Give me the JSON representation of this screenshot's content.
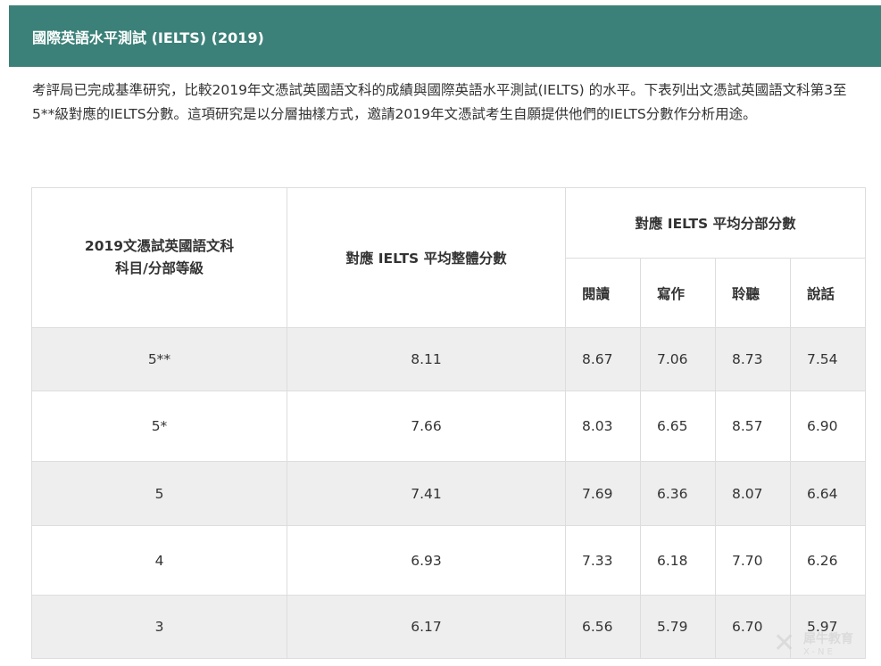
{
  "header": {
    "title": "國際英語水平測試 (IELTS) (2019)"
  },
  "intro": {
    "text": "考評局已完成基準研究，比較2019年文憑試英國語文科的成績與國際英語水平測試(IELTS) 的水平。下表列出文憑試英國語文科第3至5**級對應的IELTS分數。這項研究是以分層抽樣方式，邀請2019年文憑試考生自願提供他們的IELTS分數作分析用途。"
  },
  "table": {
    "col_subject_line1": "2019文憑試英國語文科",
    "col_subject_line2": "科目/分部等級",
    "col_overall": "對應 IELTS 平均整體分數",
    "col_sub_group": "對應 IELTS 平均分部分數",
    "sub_headers": [
      "閱讀",
      "寫作",
      "聆聽",
      "說話"
    ],
    "rows": [
      {
        "level": "5**",
        "overall": "8.11",
        "reading": "8.67",
        "writing": "7.06",
        "listening": "8.73",
        "speaking": "7.54"
      },
      {
        "level": "5*",
        "overall": "7.66",
        "reading": "8.03",
        "writing": "6.65",
        "listening": "8.57",
        "speaking": "6.90"
      },
      {
        "level": "5",
        "overall": "7.41",
        "reading": "7.69",
        "writing": "6.36",
        "listening": "8.07",
        "speaking": "6.64"
      },
      {
        "level": "4",
        "overall": "6.93",
        "reading": "7.33",
        "writing": "6.18",
        "listening": "7.70",
        "speaking": "6.26"
      },
      {
        "level": "3",
        "overall": "6.17",
        "reading": "6.56",
        "writing": "5.79",
        "listening": "6.70",
        "speaking": "5.97"
      }
    ]
  },
  "watermark": {
    "text": "犀牛教育",
    "sub": "X-NE"
  },
  "colors": {
    "header_bg": "#3b8179",
    "row_shade": "#eeeeee",
    "border": "#dddddd"
  }
}
